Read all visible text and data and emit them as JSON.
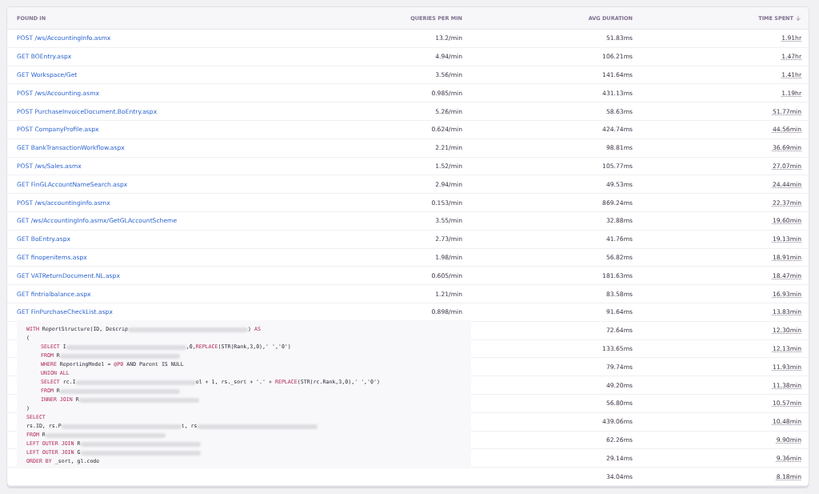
{
  "table": {
    "columns": [
      {
        "label": "FOUND IN",
        "sorted": false
      },
      {
        "label": "QUERIES PER MIN",
        "sorted": false
      },
      {
        "label": "AVG DURATION",
        "sorted": false
      },
      {
        "label": "TIME SPENT",
        "sorted": true
      }
    ],
    "rows": [
      {
        "found_in": "POST /ws/AccountingInfo.asmx",
        "queries_per_min": "13.2/min",
        "avg_duration": "51.83ms",
        "time_spent": "1.91hr"
      },
      {
        "found_in": "GET BOEntry.aspx",
        "queries_per_min": "4.94/min",
        "avg_duration": "106.21ms",
        "time_spent": "1.47hr"
      },
      {
        "found_in": "GET Workspace/Get",
        "queries_per_min": "3.56/min",
        "avg_duration": "141.64ms",
        "time_spent": "1.41hr"
      },
      {
        "found_in": "POST /ws/Accounting.asmx",
        "queries_per_min": "0.985/min",
        "avg_duration": "431.13ms",
        "time_spent": "1.19hr"
      },
      {
        "found_in": "POST PurchaseInvoiceDocument.BoEntry.aspx",
        "queries_per_min": "5.26/min",
        "avg_duration": "58.63ms",
        "time_spent": "51.77min"
      },
      {
        "found_in": "POST CompanyProfile.aspx",
        "queries_per_min": "0.624/min",
        "avg_duration": "424.74ms",
        "time_spent": "44.56min"
      },
      {
        "found_in": "GET BankTransactionWorkflow.aspx",
        "queries_per_min": "2.21/min",
        "avg_duration": "98.81ms",
        "time_spent": "36.69min"
      },
      {
        "found_in": "POST /ws/Sales.asmx",
        "queries_per_min": "1.52/min",
        "avg_duration": "105.77ms",
        "time_spent": "27.07min"
      },
      {
        "found_in": "GET FinGLAccountNameSearch.aspx",
        "queries_per_min": "2.94/min",
        "avg_duration": "49.53ms",
        "time_spent": "24.44min"
      },
      {
        "found_in": "POST /ws/accountinginfo.asmx",
        "queries_per_min": "0.153/min",
        "avg_duration": "869.24ms",
        "time_spent": "22.37min"
      },
      {
        "found_in": "GET /ws/AccountingInfo.asmx/GetGLAccountScheme",
        "queries_per_min": "3.55/min",
        "avg_duration": "32.88ms",
        "time_spent": "19.60min"
      },
      {
        "found_in": "GET BoEntry.aspx",
        "queries_per_min": "2.73/min",
        "avg_duration": "41.76ms",
        "time_spent": "19.13min"
      },
      {
        "found_in": "GET finopenitems.aspx",
        "queries_per_min": "1.98/min",
        "avg_duration": "56.82ms",
        "time_spent": "18.91min"
      },
      {
        "found_in": "GET VATReturnDocument.NL.aspx",
        "queries_per_min": "0.605/min",
        "avg_duration": "181.63ms",
        "time_spent": "18.47min"
      },
      {
        "found_in": "GET fintrialbalance.aspx",
        "queries_per_min": "1.21/min",
        "avg_duration": "83.58ms",
        "time_spent": "16.93min"
      },
      {
        "found_in": "GET FinPurchaseCheckList.aspx",
        "queries_per_min": "0.898/min",
        "avg_duration": "91.64ms",
        "time_spent": "13.83min"
      },
      {
        "avg_duration": "72.64ms",
        "time_spent": "12.30min"
      },
      {
        "avg_duration": "133.65ms",
        "time_spent": "12.13min"
      },
      {
        "avg_duration": "79.74ms",
        "time_spent": "11.93min"
      },
      {
        "avg_duration": "49.20ms",
        "time_spent": "11.38min"
      },
      {
        "avg_duration": "56.80ms",
        "time_spent": "10.57min"
      },
      {
        "avg_duration": "439.06ms",
        "time_spent": "10.48min"
      },
      {
        "avg_duration": "62.26ms",
        "time_spent": "9.90min"
      },
      {
        "avg_duration": "29.14ms",
        "time_spent": "9.36min"
      },
      {
        "avg_duration": "34.04ms",
        "time_spent": "8.18min"
      }
    ]
  },
  "query_popup": {
    "lines": [
      {
        "indented": false,
        "segments": [
          {
            "kind": "keyword",
            "text": "WITH"
          },
          {
            "kind": "plain",
            "text": " ReportStructure(ID, Descrip"
          },
          {
            "kind": "redacted"
          },
          {
            "kind": "plain",
            "text": ") "
          },
          {
            "kind": "keyword",
            "text": "AS"
          }
        ]
      },
      {
        "indented": false,
        "segments": [
          {
            "kind": "plain",
            "text": "("
          }
        ]
      },
      {
        "indented": true,
        "segments": [
          {
            "kind": "keyword",
            "text": "SELECT"
          },
          {
            "kind": "plain",
            "text": " I"
          },
          {
            "kind": "redacted"
          },
          {
            "kind": "plain",
            "text": ",0,"
          },
          {
            "kind": "keyword",
            "text": "REPLACE"
          },
          {
            "kind": "plain",
            "text": "(STR(Rank,3,0),' ','0')"
          }
        ]
      },
      {
        "indented": true,
        "segments": [
          {
            "kind": "keyword",
            "text": "FROM"
          },
          {
            "kind": "plain",
            "text": " R"
          },
          {
            "kind": "redacted"
          }
        ]
      },
      {
        "indented": true,
        "segments": [
          {
            "kind": "keyword",
            "text": "WHERE"
          },
          {
            "kind": "plain",
            "text": " ReportingModel = "
          },
          {
            "kind": "keyword",
            "text": "@P0"
          },
          {
            "kind": "plain",
            "text": " AND Parent IS NULL"
          }
        ]
      },
      {
        "indented": true,
        "segments": [
          {
            "kind": "keyword",
            "text": "UNION ALL"
          }
        ]
      },
      {
        "indented": true,
        "segments": [
          {
            "kind": "keyword",
            "text": "SELECT"
          },
          {
            "kind": "plain",
            "text": " rc.I"
          },
          {
            "kind": "redacted"
          },
          {
            "kind": "plain",
            "text": "el + 1, rs._sort + '.' + "
          },
          {
            "kind": "keyword",
            "text": "REPLACE"
          },
          {
            "kind": "plain",
            "text": "(STR(rc.Rank,3,0),' ','0')"
          }
        ]
      },
      {
        "indented": true,
        "segments": [
          {
            "kind": "keyword",
            "text": "FROM"
          },
          {
            "kind": "plain",
            "text": " R"
          },
          {
            "kind": "redacted"
          }
        ]
      },
      {
        "indented": true,
        "segments": [
          {
            "kind": "keyword",
            "text": "INNER JOIN"
          },
          {
            "kind": "plain",
            "text": " R"
          },
          {
            "kind": "redacted"
          }
        ]
      },
      {
        "indented": false,
        "segments": [
          {
            "kind": "plain",
            "text": ")"
          }
        ]
      },
      {
        "indented": false,
        "segments": [
          {
            "kind": "keyword",
            "text": "SELECT"
          }
        ]
      },
      {
        "indented": false,
        "segments": [
          {
            "kind": "plain",
            "text": "rs.ID, rs.P"
          },
          {
            "kind": "redacted"
          },
          {
            "kind": "plain",
            "text": "t, rs"
          },
          {
            "kind": "redacted"
          }
        ]
      },
      {
        "indented": false,
        "segments": [
          {
            "kind": "keyword",
            "text": "FROM"
          },
          {
            "kind": "plain",
            "text": " R"
          },
          {
            "kind": "redacted"
          }
        ]
      },
      {
        "indented": false,
        "segments": [
          {
            "kind": "keyword",
            "text": "LEFT OUTER JOIN"
          },
          {
            "kind": "plain",
            "text": " R"
          },
          {
            "kind": "redacted"
          }
        ]
      },
      {
        "indented": false,
        "segments": [
          {
            "kind": "keyword",
            "text": "LEFT OUTER JOIN"
          },
          {
            "kind": "plain",
            "text": " G"
          },
          {
            "kind": "redacted"
          }
        ]
      },
      {
        "indented": false,
        "segments": [
          {
            "kind": "keyword",
            "text": "ORDER BY"
          },
          {
            "kind": "plain",
            "text": " _sort, gl.code"
          }
        ]
      }
    ]
  }
}
